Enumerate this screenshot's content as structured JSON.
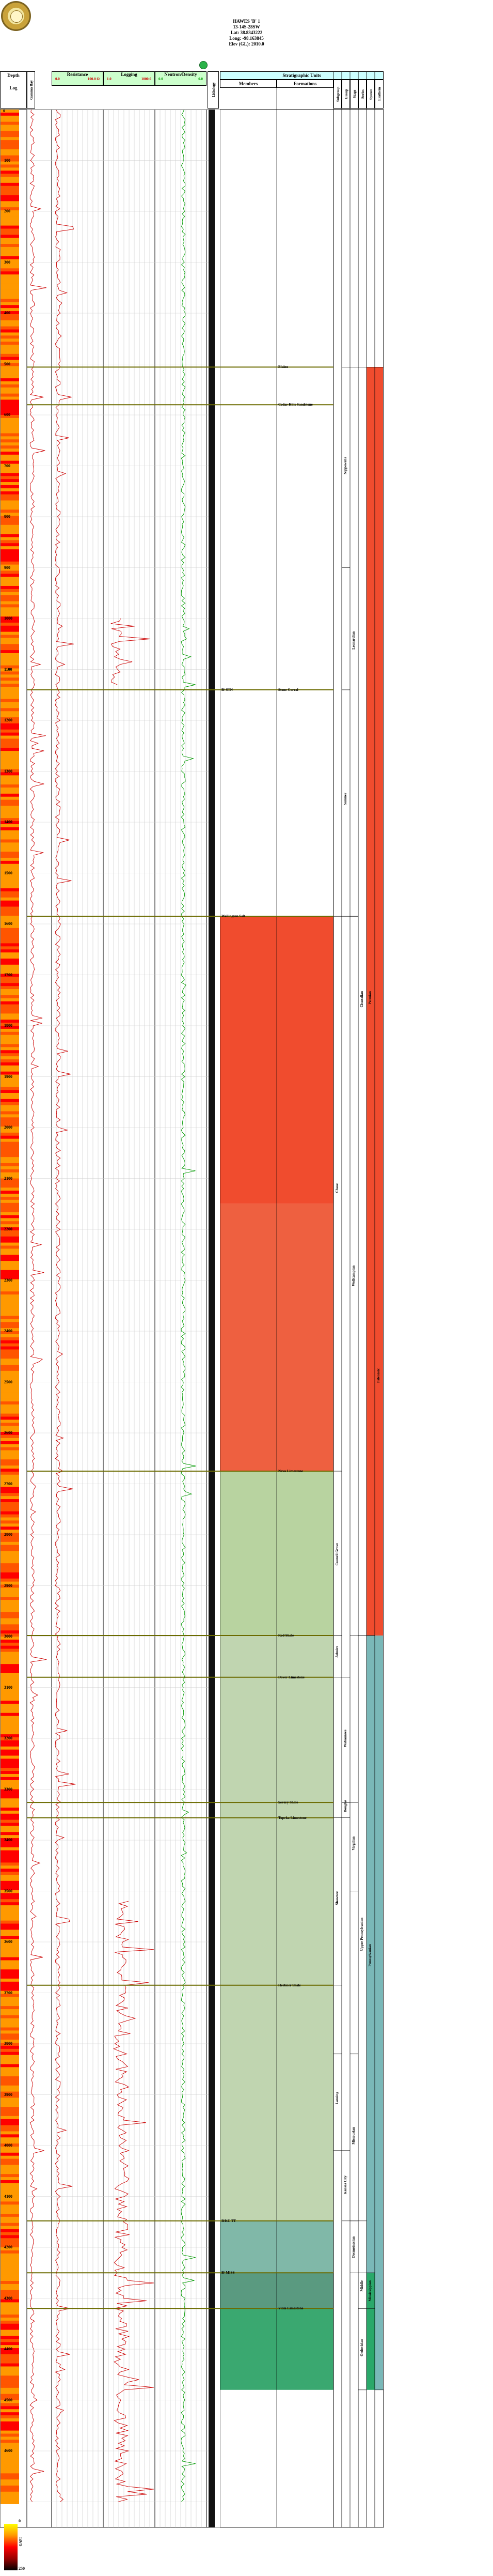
{
  "well": {
    "name": "HAWES 'B' 1",
    "location": "13-14S-28SW",
    "lat": "Lat: 38.8343222",
    "long": "Long: -98.163845",
    "elev": "Elev (GL): 2010.0"
  },
  "header": {
    "depth_title": "Depth",
    "depth_sub": "Log",
    "gamma_ray": "Gamma Ray",
    "resistivity": "Resistance",
    "resistivity_scale": "1.0",
    "resistivity_scale_b": "100.0",
    "res_low": "0.0",
    "res_high": "100.0 Ω",
    "res_mid": "0.0",
    "logging": "Logging",
    "log_low": "1.0",
    "log_high": "1000.0",
    "neutron_density": "Neutron/Density",
    "nd_low": "0.0",
    "nd_high": "0.0",
    "lithology": "Lithology",
    "strat_units": "Stratigraphic Units",
    "members": "Members",
    "formations": "Formations",
    "col_labels": [
      "Subgroup",
      "Group",
      "Stage",
      "Series",
      "System",
      "Erathem"
    ],
    "gr_scale_min": "0",
    "gr_scale_max": "250",
    "gr_scale_unit": "GAPI"
  },
  "depth_ticks": [
    "100",
    "200",
    "300",
    "400",
    "500",
    "600",
    "700",
    "800",
    "900",
    "1000",
    "1100",
    "1200",
    "1300",
    "1400",
    "1500",
    "1600",
    "1700",
    "1800",
    "1900",
    "2000",
    "2100",
    "2200",
    "2300",
    "2400",
    "2500",
    "2600",
    "2700",
    "2800",
    "2900",
    "3000",
    "3100",
    "3200",
    "3300",
    "3400",
    "3500",
    "3600",
    "3700",
    "3800",
    "3900",
    "4000",
    "4100",
    "4200",
    "4300",
    "4400",
    "4500",
    "4600"
  ],
  "depth_zero": "0",
  "tops": [
    {
      "depth": 506,
      "member": "",
      "formation": "Blaine"
    },
    {
      "depth": 580,
      "member": "",
      "formation": "Cedar Hills Sandstone"
    },
    {
      "depth": 1140,
      "member": "B/ STN",
      "formation": "Stone Corral"
    },
    {
      "depth": 1585,
      "member": "Wellington Salt",
      "formation": ""
    },
    {
      "depth": 2675,
      "member": "",
      "formation": "Neva Limestone"
    },
    {
      "depth": 2998,
      "member": "",
      "formation": "Red Shale"
    },
    {
      "depth": 3080,
      "member": "",
      "formation": "Dover Limestone"
    },
    {
      "depth": 3326,
      "member": "",
      "formation": "Severy Shale"
    },
    {
      "depth": 3356,
      "member": "",
      "formation": "Topeka Limestone"
    },
    {
      "depth": 3685,
      "member": "",
      "formation": "Heebner Shale"
    },
    {
      "depth": 4148,
      "member": "B/KC TT",
      "formation": ""
    },
    {
      "depth": 4320,
      "member": "",
      "formation": "Viola Limestone"
    },
    {
      "depth": 4250,
      "member": "B/ MISS",
      "formation": ""
    }
  ],
  "strat_blocks": {
    "subgroup": [
      {
        "label": "Chase",
        "top": 1585,
        "bottom": 2675
      },
      {
        "label": "Council Grove",
        "top": 2675,
        "bottom": 2998
      },
      {
        "label": "Admire",
        "top": 2998,
        "bottom": 3080
      },
      {
        "label": "Shawnee",
        "top": 3356,
        "bottom": 3685
      },
      {
        "label": "Lansing",
        "top": 3820,
        "bottom": 4010
      }
    ],
    "group": [
      {
        "label": "Nippewalla",
        "top": 506,
        "bottom": 900
      },
      {
        "label": "Sumner",
        "top": 1140,
        "bottom": 1585
      },
      {
        "label": "Wabaunsee",
        "top": 3080,
        "bottom": 3326
      },
      {
        "label": "Douglas",
        "top": 3326,
        "bottom": 3356
      },
      {
        "label": "Kansas City",
        "top": 4010,
        "bottom": 4148
      }
    ],
    "stage": [
      {
        "label": "Leonardian",
        "top": 506,
        "bottom": 1585
      },
      {
        "label": "Wolfcampian",
        "top": 1585,
        "bottom": 2998
      },
      {
        "label": "Virgilian",
        "top": 3326,
        "bottom": 3500
      },
      {
        "label": "Missourian",
        "top": 3820,
        "bottom": 4148
      },
      {
        "label": "Desmoinesian",
        "top": 4148,
        "bottom": 4250
      }
    ],
    "series": [
      {
        "label": "Cisuralian",
        "top": 506,
        "bottom": 2998
      },
      {
        "label": "Upper Pennsylvanian",
        "top": 2998,
        "bottom": 4148
      },
      {
        "label": "Middle",
        "top": 4250,
        "bottom": 4320
      },
      {
        "label": "Ordovician",
        "top": 4320,
        "bottom": 4480
      }
    ],
    "system": [
      {
        "label": "Permian",
        "top": 506,
        "bottom": 2998
      },
      {
        "label": "Pennsylvanian",
        "top": 2998,
        "bottom": 4250
      },
      {
        "label": "Mississippian",
        "top": 4250,
        "bottom": 4320
      }
    ],
    "erathem": [
      {
        "label": "Paleozoic",
        "top": 506,
        "bottom": 4480
      }
    ]
  },
  "colors": {
    "header_green": "#ccffcc",
    "header_cyan": "#ccffff",
    "red_curve": "#cc0000",
    "green_curve": "#009900",
    "permian_red": "#f04c2e",
    "permian_red2": "#ee6040",
    "pale_green": "#b8d3a0",
    "penn_green": "#c0d5b0",
    "miss_teal": "#80b8a8",
    "ordo_green": "#3aa870",
    "system_teal": "#7ab8b8",
    "system_green": "#2aa86a",
    "top_line": "#6b6b00",
    "gr_hot": "#ff0000",
    "gr_warm": "#ff9900"
  },
  "gr_scale_colors": [
    "#ffff00",
    "#ff9900",
    "#ff0000",
    "#990000",
    "#000000"
  ]
}
